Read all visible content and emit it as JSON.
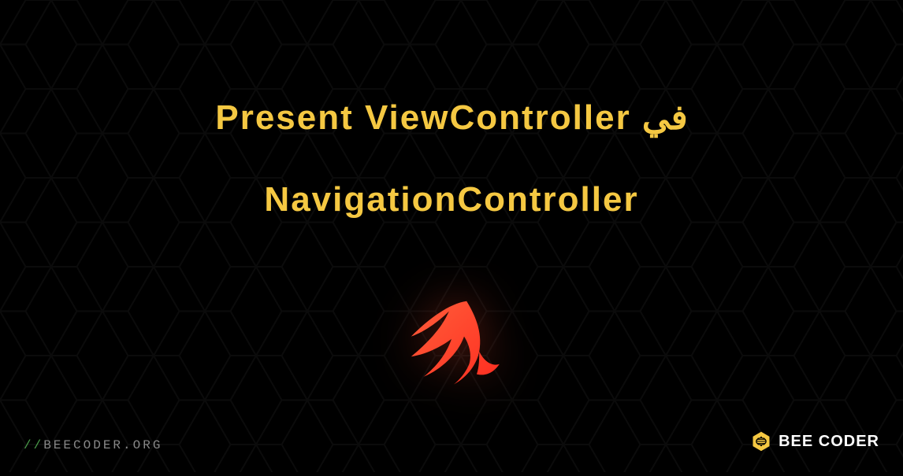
{
  "title": {
    "line1": "Present ViewController في",
    "line2": "NavigationController"
  },
  "footer": {
    "url_prefix": "//",
    "url": "BEECODER.ORG",
    "logo_text_bold": "BEE",
    "logo_text_light": " CODER"
  }
}
